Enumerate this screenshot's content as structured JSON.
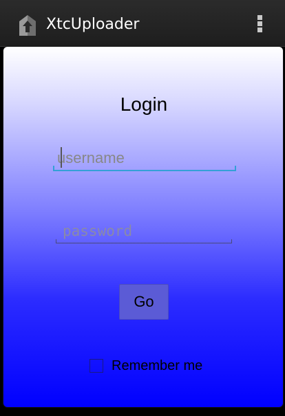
{
  "action_bar": {
    "app_title": "XtcUploader",
    "app_icon": "upload-home-icon",
    "overflow_icon": "overflow-menu-icon"
  },
  "login": {
    "title": "Login",
    "username_placeholder": "username",
    "username_value": "",
    "password_placeholder": "password",
    "password_value": "",
    "go_label": "Go",
    "remember_label": "Remember me",
    "remember_checked": false
  },
  "colors": {
    "gradient_top": "#ffffff",
    "gradient_bottom": "#0000ff",
    "focus_underline": "#33a0d6",
    "action_bar": "#222222"
  }
}
